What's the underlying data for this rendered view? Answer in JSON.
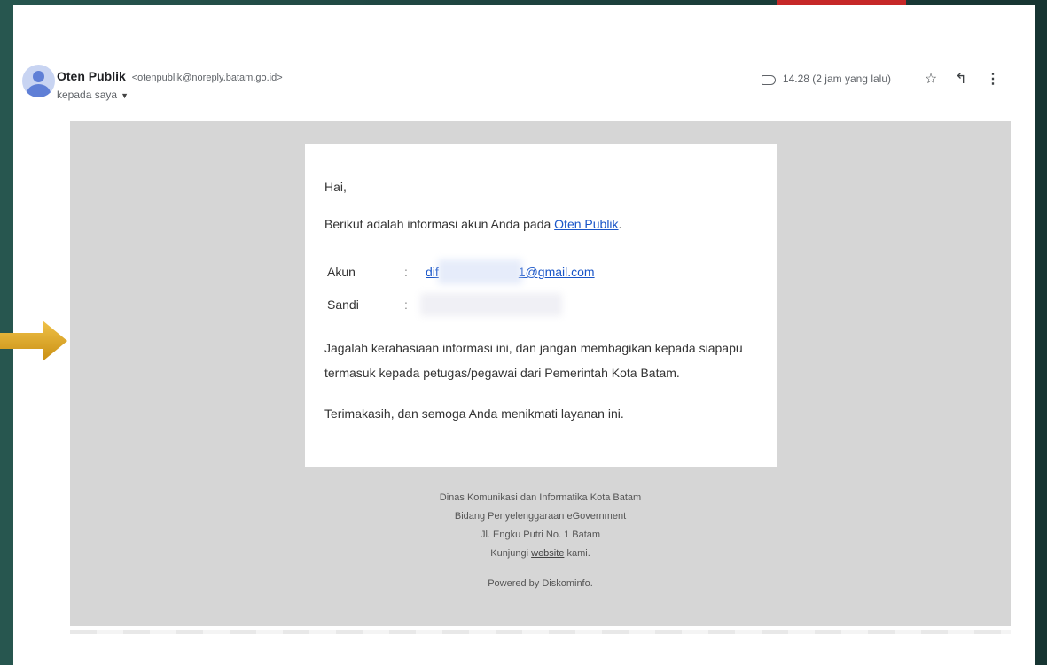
{
  "sender": {
    "name": "Oten Publik",
    "email": "<otenpublik@noreply.batam.go.id>",
    "recipient": "kepada saya"
  },
  "meta": {
    "time": "14.28 (2 jam yang lalu)"
  },
  "message": {
    "greeting": "Hai,",
    "intro_text": "Berikut adalah informasi akun Anda pada",
    "intro_link": "Oten Publik",
    "intro_end": ".",
    "account_label": "Akun",
    "account_value_start": "dif",
    "account_value_end": "1@gmail.com",
    "password_label": "Sandi",
    "colon": ":",
    "warning_line1": "Jagalah kerahasiaan informasi ini, dan jangan membagikan kepada siapapu",
    "warning_line2": "termasuk kepada petugas/pegawai dari Pemerintah Kota Batam.",
    "closing": "Terimakasih, dan semoga Anda menikmati layanan ini."
  },
  "footer": {
    "line1": "Dinas Komunikasi dan Informatika Kota Batam",
    "line2": "Bidang Penyelenggaraan eGovernment",
    "line3": "Jl. Engku Putri No. 1 Batam",
    "line4_prefix": "Kunjungi",
    "line4_link": "website",
    "line4_suffix": "kami.",
    "powered": "Powered by Diskominfo."
  },
  "icons": {
    "label": "label-icon",
    "star": "star-icon",
    "reply": "reply-icon",
    "more": "more-vertical-icon",
    "avatar": "avatar-icon",
    "arrow": "arrow-right-icon"
  },
  "colors": {
    "link": "#1a56c8",
    "arrow": "#e0a826",
    "background": "#1f4a45",
    "body_grey": "#d6d6d6"
  }
}
